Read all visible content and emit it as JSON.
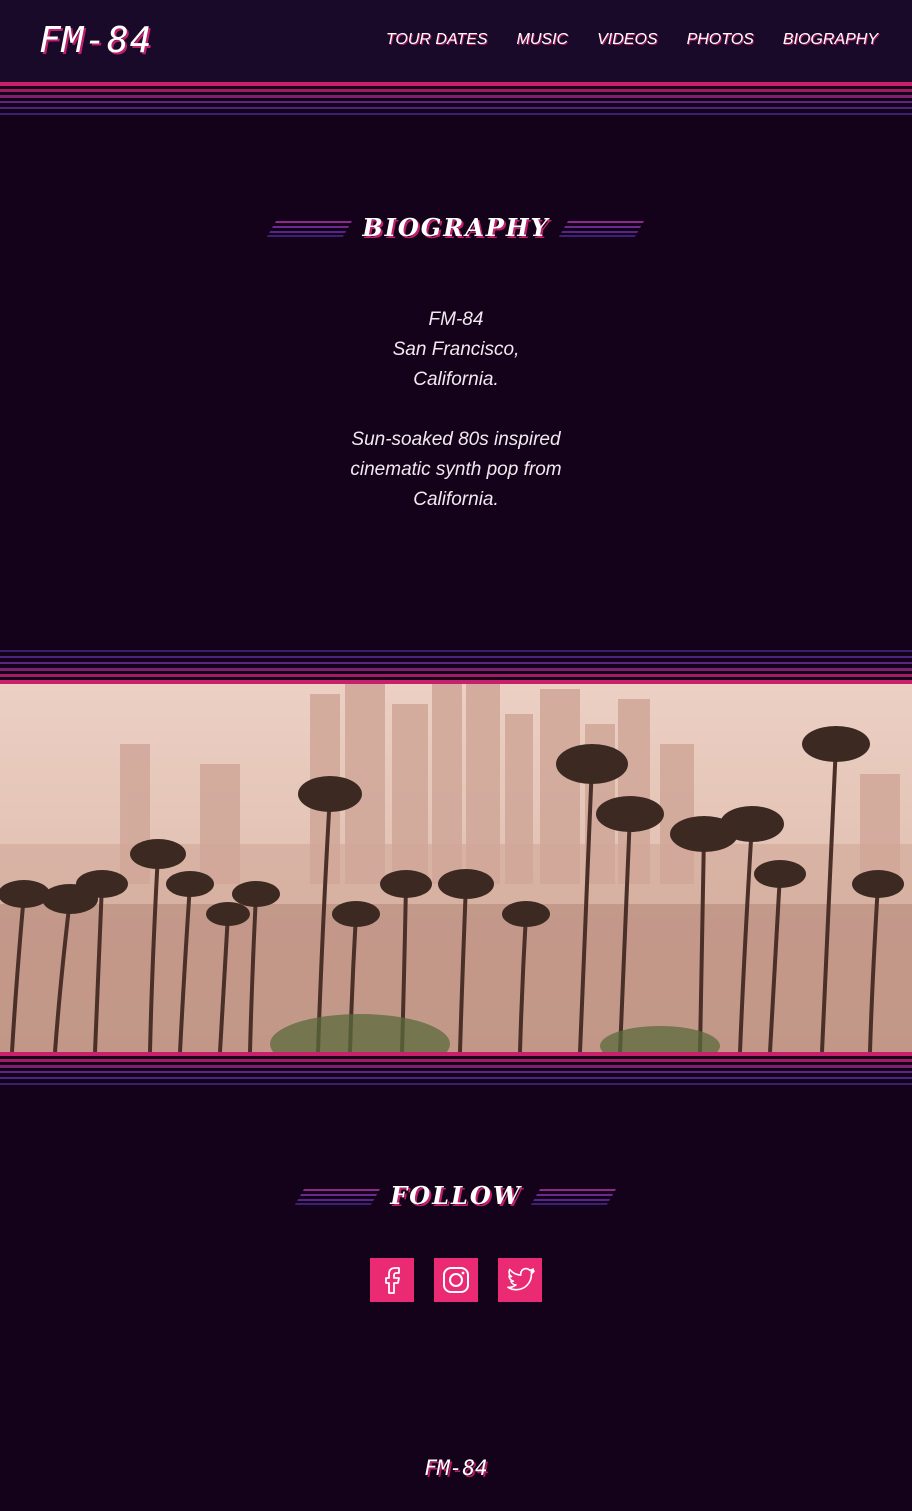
{
  "header": {
    "logo": "FM-84",
    "nav": [
      {
        "label": "TOUR DATES"
      },
      {
        "label": "MUSIC"
      },
      {
        "label": "VIDEOS"
      },
      {
        "label": "PHOTOS"
      },
      {
        "label": "BIOGRAPHY"
      }
    ]
  },
  "biography": {
    "title": "BIOGRAPHY",
    "lines": [
      "FM-84",
      "San Francisco,",
      "California."
    ],
    "tagline": [
      "Sun-soaked 80s inspired",
      "cinematic synth pop from",
      "California."
    ]
  },
  "follow": {
    "title": "FOLLOW",
    "icons": [
      "facebook-icon",
      "instagram-icon",
      "twitter-icon"
    ]
  },
  "footer": {
    "logo": "FM-84"
  },
  "colors": {
    "background": "#14021a",
    "header": "#180a28",
    "accent_pink": "#ea2b74",
    "stripe_purple": "#5b2a8c"
  }
}
